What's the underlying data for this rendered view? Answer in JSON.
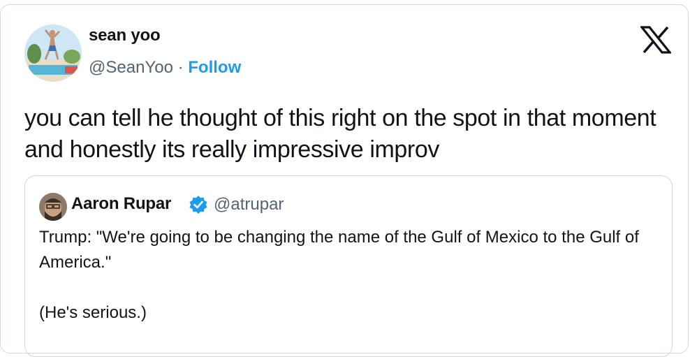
{
  "author": {
    "display_name": "sean yoo",
    "handle": "@SeanYoo",
    "separator": " · ",
    "follow_label": "Follow"
  },
  "platform_icon": "x-logo-icon",
  "tweet": {
    "text": "you can tell he thought of this right on the spot in that moment and honestly its really impressive improv"
  },
  "quoted_tweet": {
    "display_name": "Aaron Rupar",
    "verified_icon": "verified-badge-icon",
    "handle": "@atrupar",
    "line1": "Trump: \"We're going to be changing the name of the Gulf of Mexico to the Gulf of America.\"",
    "line2": "(He's serious.)"
  },
  "colors": {
    "link": "#1d9bf0",
    "secondary_text": "#536471",
    "border": "#cfd9de"
  }
}
